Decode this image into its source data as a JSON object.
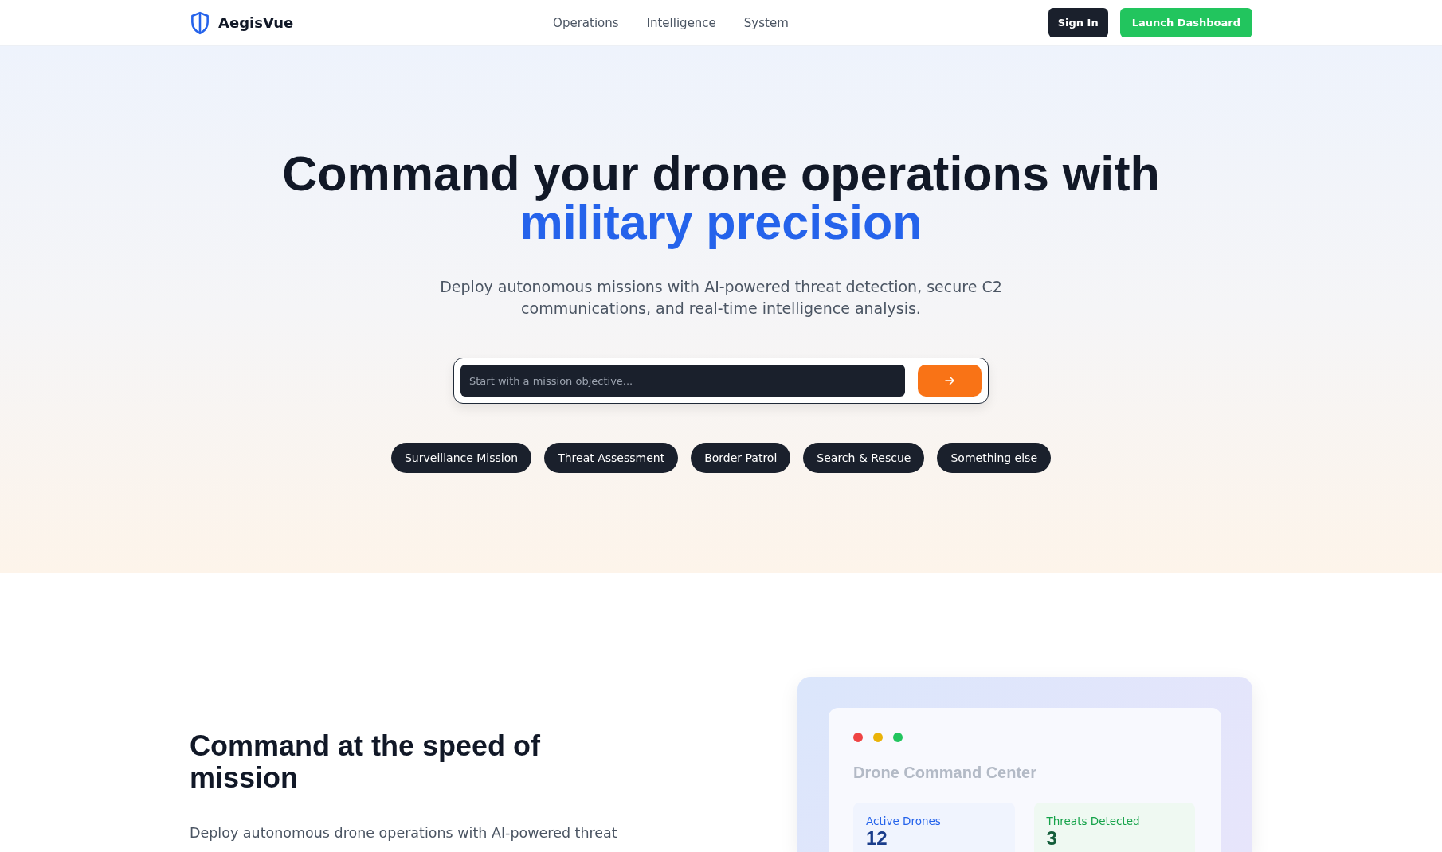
{
  "header": {
    "brand": "AegisVue",
    "nav": [
      {
        "label": "Operations"
      },
      {
        "label": "Intelligence"
      },
      {
        "label": "System"
      }
    ],
    "buttons": [
      {
        "label": "Sign In",
        "kind": "secondary"
      },
      {
        "label": "Launch Dashboard",
        "kind": "primary"
      }
    ]
  },
  "hero": {
    "title": "Command your drone operations with",
    "title_highlight": "military precision",
    "subtitle": "Deploy autonomous missions with AI-powered threat detection, secure C2 communications, and real-time intelligence analysis.",
    "search": {
      "placeholder": "Start with a mission objective..."
    },
    "suggestions": [
      {
        "label": "Surveillance Mission"
      },
      {
        "label": "Threat Assessment"
      },
      {
        "label": "Border Patrol"
      },
      {
        "label": "Search & Rescue"
      },
      {
        "label": "Something else"
      }
    ]
  },
  "feature": {
    "heading": "Command at the speed of mission",
    "text": "Deploy autonomous drone operations with AI-powered threat",
    "preview": {
      "dots": [
        {
          "color": "#ef4444"
        },
        {
          "color": "#eab308"
        },
        {
          "color": "#22c55e"
        }
      ],
      "title": "Drone Command Center",
      "stats": [
        {
          "label": "Active Drones",
          "value": "12",
          "color": "#2563eb"
        },
        {
          "label": "Threats Detected",
          "value": "3",
          "color": "#16a34a"
        }
      ]
    }
  }
}
